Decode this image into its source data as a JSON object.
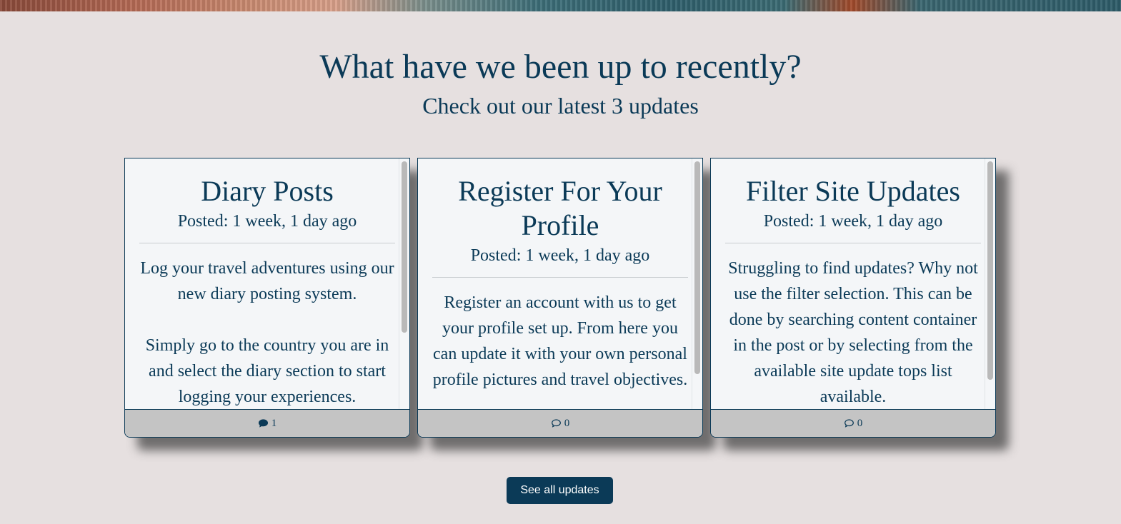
{
  "section": {
    "title": "What have we been up to recently?",
    "subtitle": "Check out our latest 3 updates"
  },
  "cards": [
    {
      "title": "Diary Posts",
      "posted": "Posted: 1 week, 1 day ago",
      "paragraphs": [
        "Log your travel adventures using our new diary posting system.",
        "Simply go to the country you are in and select the diary section to start logging your experiences."
      ],
      "comment_icon": "comment-filled-icon",
      "comment_count": "1"
    },
    {
      "title": "Register For Your Profile",
      "posted": "Posted: 1 week, 1 day ago",
      "paragraphs": [
        "Register an account with us to get your profile set up. From here you can update it with your own personal profile pictures and travel objectives."
      ],
      "comment_icon": "comment-outline-icon",
      "comment_count": "0"
    },
    {
      "title": "Filter Site Updates",
      "posted": "Posted: 1 week, 1 day ago",
      "paragraphs": [
        "Struggling to find updates? Why not use the filter selection. This can be done by searching content container in the post or by selecting from the available site update tops list available."
      ],
      "comment_icon": "comment-outline-icon",
      "comment_count": "0"
    }
  ],
  "cta": {
    "label": "See all updates"
  },
  "colors": {
    "primary": "#0b3a57",
    "background": "#e6e0e0",
    "card": "#f4f6f8",
    "footer": "#c4c4c4"
  }
}
